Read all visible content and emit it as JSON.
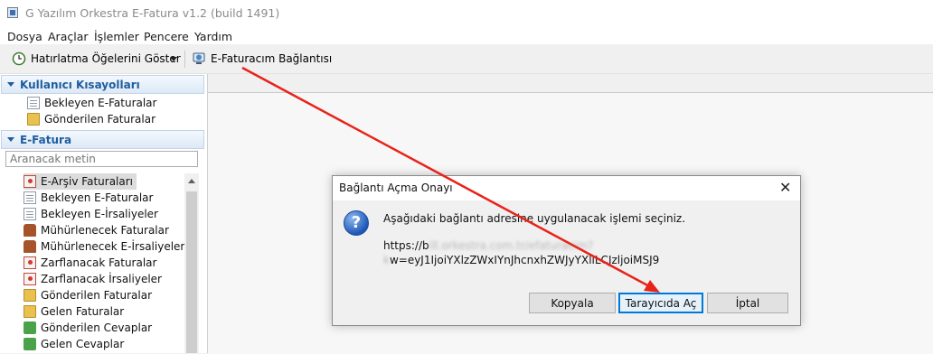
{
  "window": {
    "title": "G Yazılım Orkestra E-Fatura v1.2 (build 1491)"
  },
  "menu": [
    "Dosya",
    "Araçlar",
    "İşlemler",
    "Pencere",
    "Yardım"
  ],
  "toolbar": {
    "reminders_label": "Hatırlatma Öğelerini Göster",
    "connection_label": "E-Faturacım Bağlantısı"
  },
  "shortcuts": {
    "header": "Kullanıcı Kısayolları",
    "items": [
      "Bekleyen E-Faturalar",
      "Gönderilen Faturalar"
    ]
  },
  "efatura": {
    "header": "E-Fatura",
    "search_placeholder": "Aranacak metin",
    "items": [
      "E-Arşiv Faturaları",
      "Bekleyen E-Faturalar",
      "Bekleyen E-İrsaliyeler",
      "Mühürlenecek Faturalar",
      "Mühürlenecek E-İrsaliyeler",
      "Zarflanacak Faturalar",
      "Zarflanacak İrsaliyeler",
      "Gönderilen Faturalar",
      "Gelen Faturalar",
      "Gönderilen Cevaplar",
      "Gelen Cevaplar"
    ]
  },
  "dialog": {
    "title": "Bağlantı Açma Onayı",
    "message": "Aşağıdaki bağlantı adresine uygulanacak işlemi seçiniz.",
    "url_start": "https://b",
    "url_blurred": "ill.orkestra.com.tr/efaturacim?k",
    "url_end": "w=eyJ1IjoiYXlzZWxIYnJhcnxhZWJyYXliLCJzljoiMSJ9",
    "buttons": {
      "copy": "Kopyala",
      "open": "Tarayıcıda Aç",
      "cancel": "İptal"
    }
  },
  "colors": {
    "accent": "#1f5da0",
    "annotation": "#e8231a"
  }
}
